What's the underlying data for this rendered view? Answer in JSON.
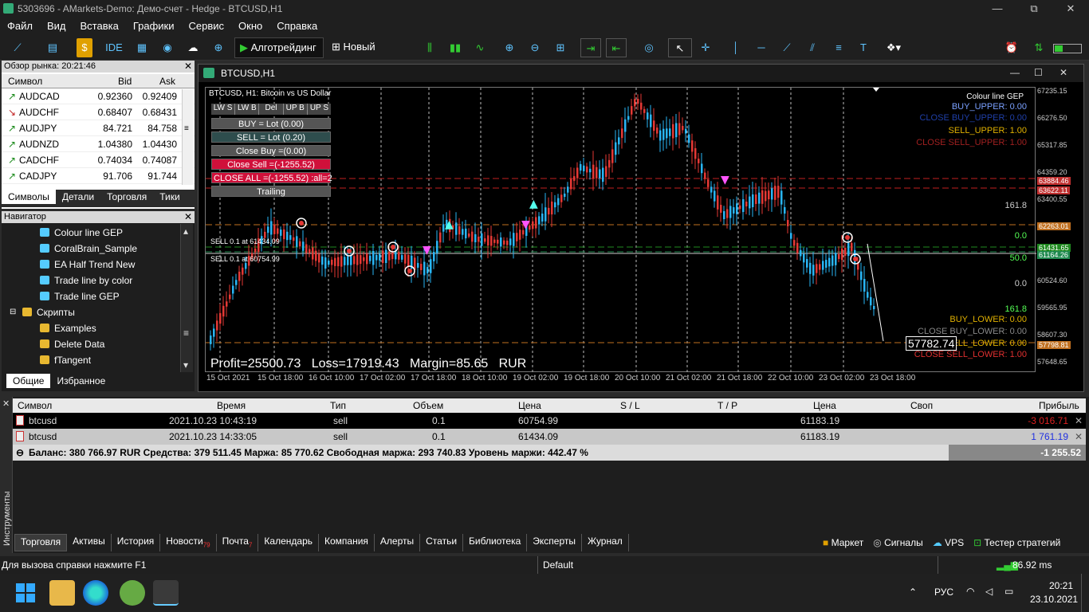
{
  "window": {
    "title": "5303696 - AMarkets-Demo: Демо-счет - Hedge - BTCUSD,H1",
    "min": "—",
    "max": "⧉",
    "close": "✕"
  },
  "menu": [
    "Файл",
    "Вид",
    "Вставка",
    "Графики",
    "Сервис",
    "Окно",
    "Справка"
  ],
  "toolbar": {
    "algo": "Алготрейдинг",
    "new_order": "Новый ордер",
    "ide": "IDE"
  },
  "market_watch": {
    "header": "Обзор рынка: 20:21:46",
    "cols": [
      "Символ",
      "Bid",
      "Ask"
    ],
    "rows": [
      {
        "s": "AUDCAD",
        "b": "0.92360",
        "a": "0.92409",
        "dir": "up"
      },
      {
        "s": "AUDCHF",
        "b": "0.68407",
        "a": "0.68431",
        "dir": "down"
      },
      {
        "s": "AUDJPY",
        "b": "84.721",
        "a": "84.758",
        "dir": "up"
      },
      {
        "s": "AUDNZD",
        "b": "1.04380",
        "a": "1.04430",
        "dir": "up"
      },
      {
        "s": "CADCHF",
        "b": "0.74034",
        "a": "0.74087",
        "dir": "up"
      },
      {
        "s": "CADJPY",
        "b": "91.706",
        "a": "91.744",
        "dir": "up"
      }
    ],
    "tabs": [
      "Символы",
      "Детали",
      "Торговля",
      "Тики"
    ]
  },
  "navigator": {
    "header": "Навигатор",
    "items": [
      {
        "l": "Colour line GEP",
        "lvl": 2
      },
      {
        "l": "CoralBrain_Sample",
        "lvl": 2
      },
      {
        "l": "EA Half Trend New",
        "lvl": 2
      },
      {
        "l": "Trade line by color",
        "lvl": 2
      },
      {
        "l": "Trade line GEP",
        "lvl": 2
      },
      {
        "l": "Скрипты",
        "lvl": 1
      },
      {
        "l": "Examples",
        "lvl": 2
      },
      {
        "l": "Delete Data",
        "lvl": 2
      },
      {
        "l": "fTangent",
        "lvl": 2
      }
    ],
    "tabs": [
      "Общие",
      "Избранное"
    ]
  },
  "chart": {
    "window_title": "BTCUSD,H1",
    "header": "BTCUSD, H1:  Bitcoin vs US Dollar",
    "indicator": "Colour line GEP",
    "panel": {
      "row1": [
        "LW S",
        "LW B",
        "Del",
        "UP B",
        "UP S"
      ],
      "buy": "BUY = Lot (0.00)",
      "sell": "SELL = Lot (0.20)",
      "close_buy": "Close  Buy =(0.00)",
      "close_sell": "Close  Sell =(-1255.52)",
      "close_all": "CLOSE  ALL =(-1255.52) :all=2",
      "trailing": "Trailing"
    },
    "sell1": "SELL 0.1 at 61434.09",
    "sell2": "SELL 0.1 at 60754.99",
    "profit_line": "Profit=25500.73   Loss=17919.43   Margin=85.65   RUR",
    "right_labels": [
      {
        "t": "BUY_UPPER: 0.00",
        "c": "#7aa0ff"
      },
      {
        "t": "CLOSE BUY_UPPER: 0.00",
        "c": "#1f3fa8"
      },
      {
        "t": "SELL_UPPER: 1.00",
        "c": "#e0b000"
      },
      {
        "t": "CLOSE SELL_UPPER: 1.00",
        "c": "#a02020"
      },
      {
        "t": "161.8",
        "c": "#ccc"
      },
      {
        "t": "0.0",
        "c": "#5f5"
      },
      {
        "t": "50.0",
        "c": "#5f5"
      },
      {
        "t": "0.0",
        "c": "#ccc"
      },
      {
        "t": "161.8",
        "c": "#5f5"
      },
      {
        "t": "BUY_LOWER: 0.00",
        "c": "#e0b000"
      },
      {
        "t": "CLOSE BUY_LOWER: 0.00",
        "c": "#888"
      },
      {
        "t": "SELL_LOWER: 0.00",
        "c": "#e0b000"
      },
      {
        "t": "CLOSE SELL_LOWER: 1.00",
        "c": "#e03030"
      }
    ],
    "current_price": "57782.74",
    "prices": [
      "67235.15",
      "66276.50",
      "65317.85",
      "64359.20",
      "63400.55",
      "62441.90",
      "61483.25",
      "60524.60",
      "59565.95",
      "58607.30",
      "57648.65"
    ],
    "price_tags": [
      {
        "t": "63884.46",
        "c": "#c03030"
      },
      {
        "t": "63622.11",
        "c": "#c03030"
      },
      {
        "t": "62263.01",
        "c": "#c07020"
      },
      {
        "t": "61431.65",
        "c": "#208a20"
      },
      {
        "t": "61164.26",
        "c": "#208a50"
      },
      {
        "t": "57798.81",
        "c": "#c07020"
      }
    ],
    "times": [
      "15 Oct 2021",
      "15 Oct 18:00",
      "16 Oct 10:00",
      "17 Oct 02:00",
      "17 Oct 18:00",
      "18 Oct 10:00",
      "19 Oct 02:00",
      "19 Oct 18:00",
      "20 Oct 10:00",
      "21 Oct 02:00",
      "21 Oct 18:00",
      "22 Oct 10:00",
      "23 Oct 02:00",
      "23 Oct 18:00"
    ]
  },
  "terminal": {
    "cols": [
      "Символ",
      "Время",
      "Тип",
      "Объем",
      "Цена",
      "S / L",
      "T / P",
      "Цена",
      "Своп",
      "Прибыль"
    ],
    "rows": [
      {
        "sym": "btcusd",
        "time": "2021.10.23 10:43:19",
        "type": "sell",
        "vol": "0.1",
        "price": "60754.99",
        "cur": "61183.19",
        "profit": "-3 016.71",
        "pc": "#e02020"
      },
      {
        "sym": "btcusd",
        "time": "2021.10.23 14:33:05",
        "type": "sell",
        "vol": "0.1",
        "price": "61434.09",
        "cur": "61183.19",
        "profit": "1 761.19",
        "pc": "#2030e0"
      }
    ],
    "balance": "Баланс: 380 766.97 RUR  Средства: 379 511.45  Маржа: 85 770.62  Свободная маржа: 293 740.83  Уровень маржи: 442.47 %",
    "total": "-1 255.52",
    "side_label": "Инструменты",
    "tabs": [
      {
        "l": "Торговля",
        "n": ""
      },
      {
        "l": "Активы",
        "n": ""
      },
      {
        "l": "История",
        "n": ""
      },
      {
        "l": "Новости",
        "n": "79"
      },
      {
        "l": "Почта",
        "n": "7"
      },
      {
        "l": "Календарь",
        "n": ""
      },
      {
        "l": "Компания",
        "n": ""
      },
      {
        "l": "Алерты",
        "n": ""
      },
      {
        "l": "Статьи",
        "n": ""
      },
      {
        "l": "Библиотека",
        "n": ""
      },
      {
        "l": "Эксперты",
        "n": ""
      },
      {
        "l": "Журнал",
        "n": ""
      }
    ],
    "right_tabs": [
      "Маркет",
      "Сигналы",
      "VPS",
      "Тестер стратегий"
    ]
  },
  "status": {
    "help": "Для вызова справки нажмите F1",
    "profile": "Default",
    "ping": "86.92 ms"
  },
  "taskbar": {
    "lang": "РУС",
    "time": "20:21",
    "date": "23.10.2021"
  }
}
